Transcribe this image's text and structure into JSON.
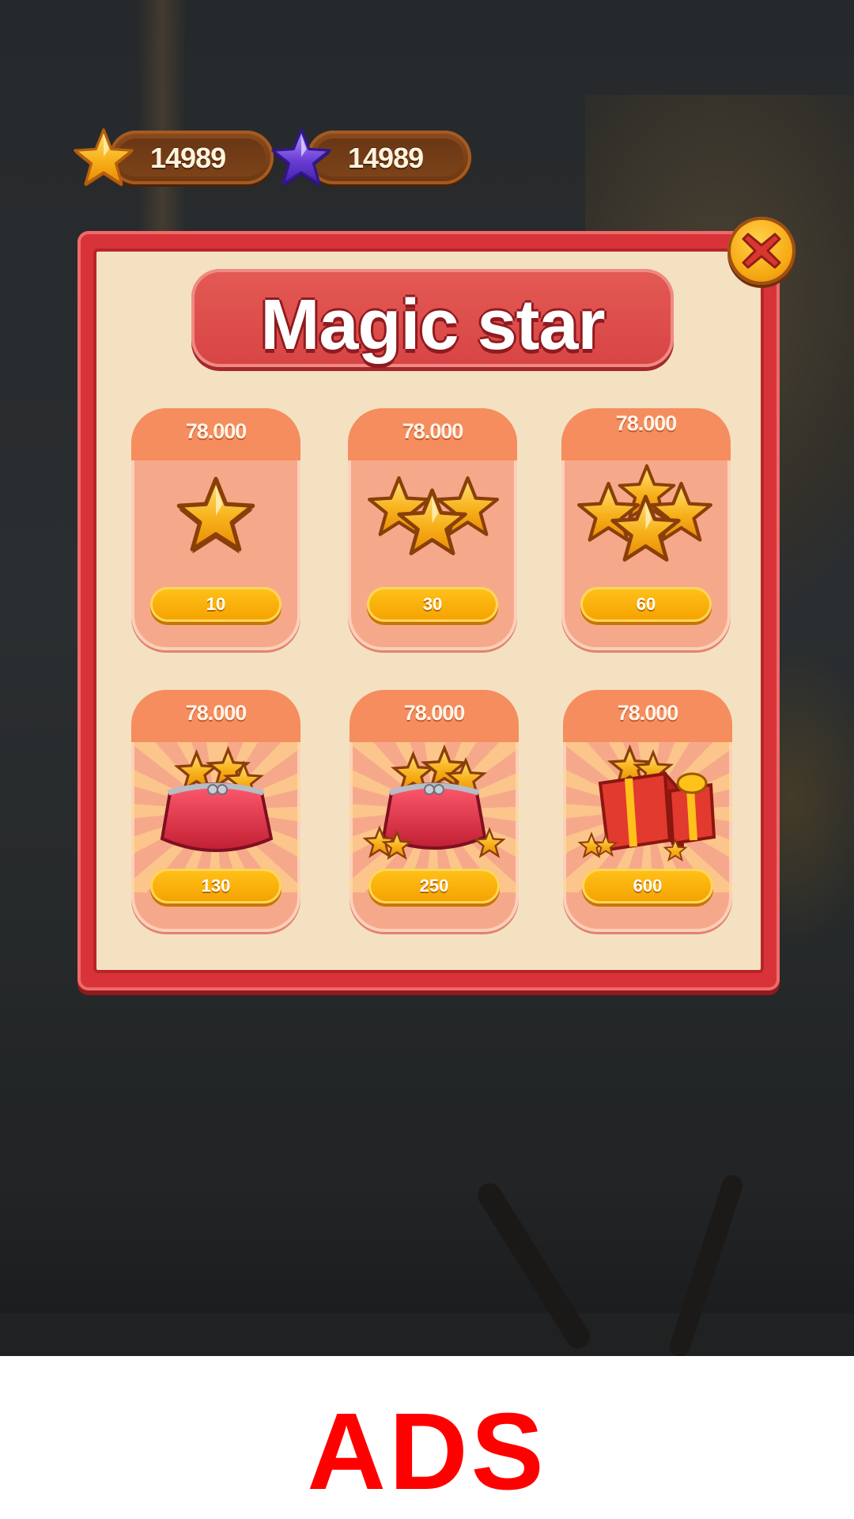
{
  "currency": {
    "gold": {
      "value": "14989",
      "icon": "gold-star-icon",
      "color": "#f7a81b"
    },
    "purple": {
      "value": "14989",
      "icon": "purple-star-icon",
      "color": "#6b3fd6"
    }
  },
  "shop": {
    "title": "Magic star",
    "close_icon": "close-icon",
    "items": [
      {
        "price": "78.000",
        "amount": "10",
        "art": "single-star-icon"
      },
      {
        "price": "78.000",
        "amount": "30",
        "art": "three-stars-icon"
      },
      {
        "price": "78.000",
        "amount": "60",
        "art": "star-pile-icon"
      },
      {
        "price": "78.000",
        "amount": "130",
        "art": "star-purse-icon"
      },
      {
        "price": "78.000",
        "amount": "250",
        "art": "big-star-purse-icon"
      },
      {
        "price": "78.000",
        "amount": "600",
        "art": "star-gift-box-icon"
      }
    ]
  },
  "ads": {
    "label": "ADS"
  },
  "colors": {
    "panel_red": "#d9333a",
    "panel_cream": "#f4e1c2",
    "button_gold": "#f5a100",
    "ads_red": "#ff0000"
  }
}
